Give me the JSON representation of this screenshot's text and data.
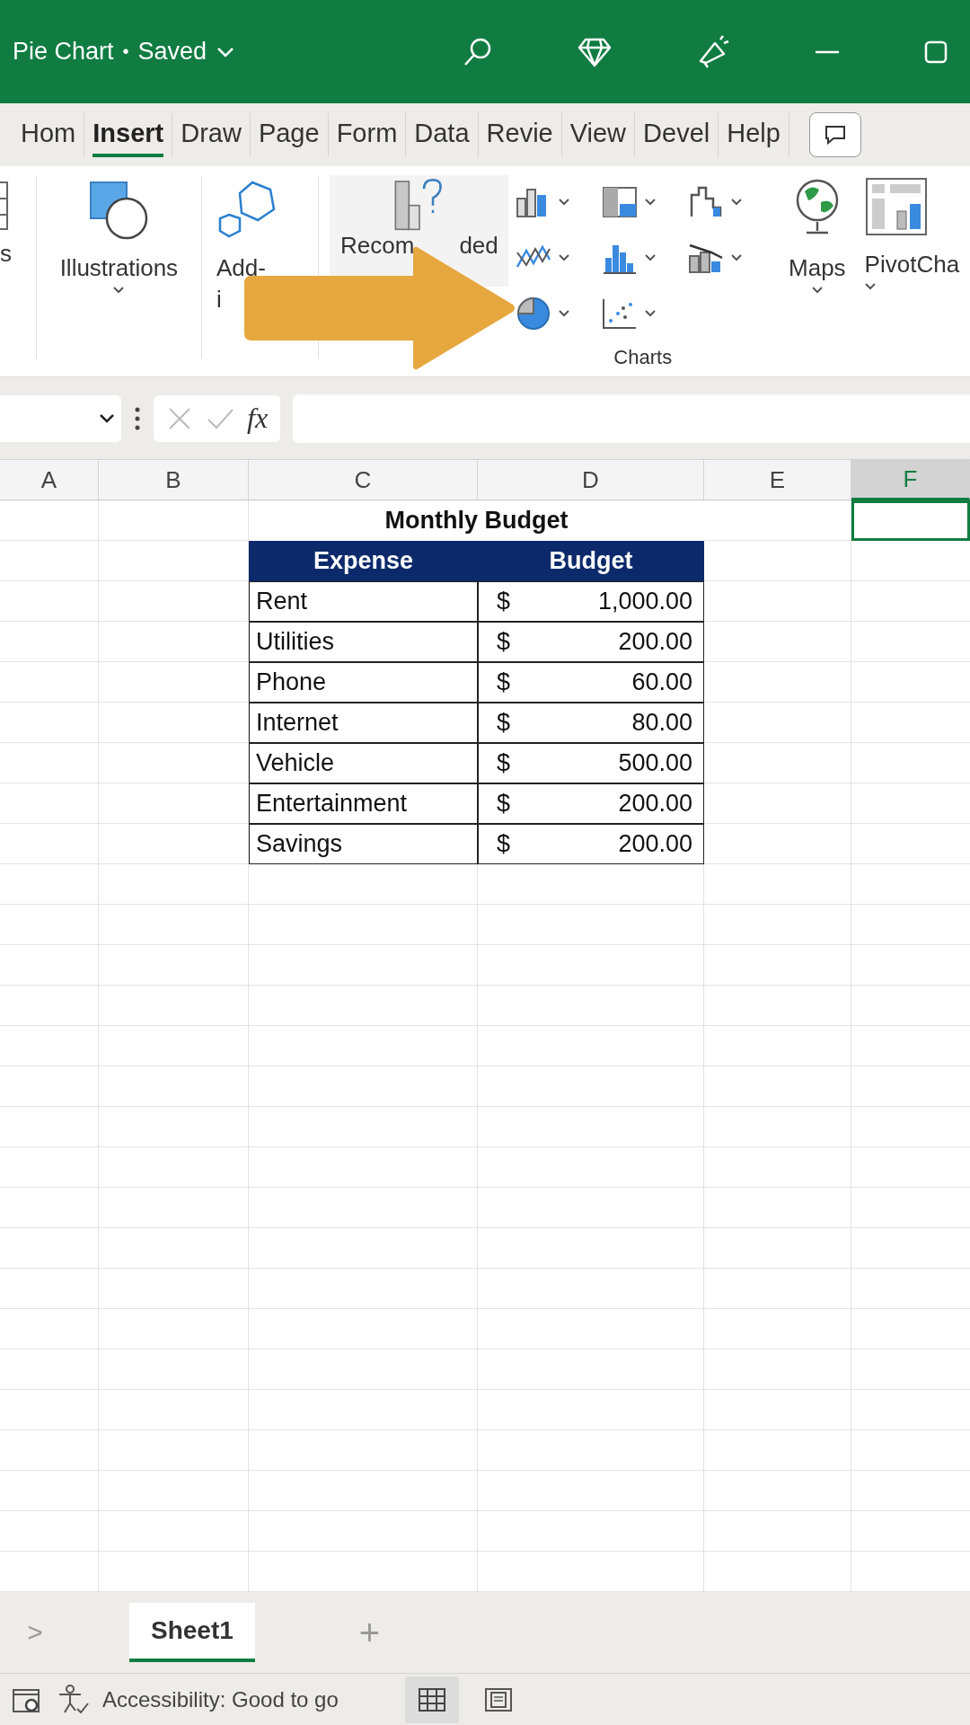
{
  "window": {
    "title": "Pie Chart",
    "separator": "•",
    "status": "Saved"
  },
  "tabs": [
    {
      "label": "Hom",
      "selected": false
    },
    {
      "label": "Insert",
      "selected": true
    },
    {
      "label": "Draw",
      "selected": false
    },
    {
      "label": "Page",
      "selected": false
    },
    {
      "label": "Form",
      "selected": false
    },
    {
      "label": "Data",
      "selected": false
    },
    {
      "label": "Revie",
      "selected": false
    },
    {
      "label": "View",
      "selected": false
    },
    {
      "label": "Devel",
      "selected": false
    },
    {
      "label": "Help",
      "selected": false
    }
  ],
  "ribbon": {
    "cut_group_label": "s",
    "illustrations": "Illustrations",
    "addins_parts": [
      "Add-",
      "i"
    ],
    "recommended_parts": [
      "Recom",
      "ded"
    ],
    "charts_label": "Charts",
    "maps": "Maps",
    "pivot": "PivotCha",
    "chart_buttons": [
      {
        "kind": "column"
      },
      {
        "kind": "hierarchy"
      },
      {
        "kind": "waterfall"
      },
      {
        "kind": "line"
      },
      {
        "kind": "statistic"
      },
      {
        "kind": "combo"
      },
      {
        "kind": "pie"
      },
      {
        "kind": "scatter"
      }
    ]
  },
  "formula_bar": {
    "function_label": "fx"
  },
  "sheet": {
    "columns": [
      {
        "label": "A",
        "selected": false
      },
      {
        "label": "B",
        "selected": false
      },
      {
        "label": "C",
        "selected": false
      },
      {
        "label": "D",
        "selected": false
      },
      {
        "label": "E",
        "selected": false
      },
      {
        "label": "F",
        "selected": true
      }
    ],
    "title": "Monthly Budget",
    "headers": [
      "Expense",
      "Budget"
    ],
    "rows": [
      {
        "expense": "Rent",
        "currency": "$",
        "amount": "1,000.00"
      },
      {
        "expense": "Utilities",
        "currency": "$",
        "amount": "200.00"
      },
      {
        "expense": "Phone",
        "currency": "$",
        "amount": "60.00"
      },
      {
        "expense": "Internet",
        "currency": "$",
        "amount": "80.00"
      },
      {
        "expense": "Vehicle",
        "currency": "$",
        "amount": "500.00"
      },
      {
        "expense": "Entertainment",
        "currency": "$",
        "amount": "200.00"
      },
      {
        "expense": "Savings",
        "currency": "$",
        "amount": "200.00"
      }
    ]
  },
  "sheet_tabs": {
    "scroll": ">",
    "tabs": [
      {
        "label": "Sheet1",
        "selected": true
      }
    ],
    "add": "+"
  },
  "status_bar": {
    "accessibility": "Accessibility: Good to go"
  }
}
